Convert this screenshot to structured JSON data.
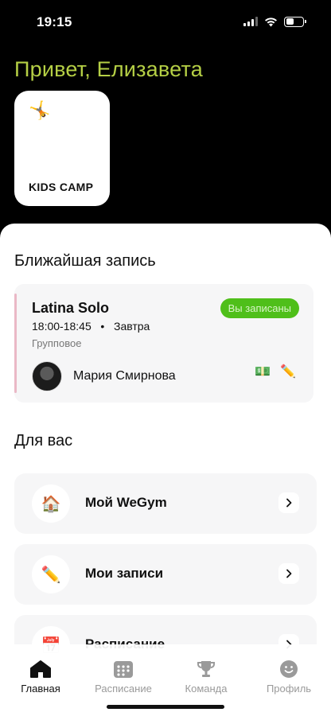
{
  "status_bar": {
    "time": "19:15"
  },
  "greeting": "Привет, Елизавета",
  "kids_card": {
    "title": "KIDS CAMP",
    "emoji": "🤸"
  },
  "nearest": {
    "section_title": "Ближайшая запись",
    "class_name": "Latina Solo",
    "time": "18:00-18:45",
    "day": "Завтра",
    "type": "Групповое",
    "badge": "Вы записаны",
    "trainer": "Мария Смирнова",
    "icons": [
      "money-icon",
      "pencil-icon"
    ],
    "accent_color": "#eab8c6",
    "badge_color": "#4fbf1a"
  },
  "for_you": {
    "section_title": "Для вас",
    "items": [
      {
        "label": "Мой WeGym",
        "emoji": "🏠",
        "icon": "house-icon"
      },
      {
        "label": "Мои записи",
        "emoji": "✏️",
        "icon": "pencil-icon"
      },
      {
        "label": "Расписание",
        "emoji": "📅",
        "icon": "calendar-icon"
      }
    ]
  },
  "tabs": [
    {
      "label": "Главная",
      "icon": "home-icon",
      "active": true
    },
    {
      "label": "Расписание",
      "icon": "calendar-icon",
      "active": false
    },
    {
      "label": "Команда",
      "icon": "trophy-icon",
      "active": false
    },
    {
      "label": "Профиль",
      "icon": "smile-icon",
      "active": false
    }
  ],
  "colors": {
    "greeting": "#b5cf45",
    "background": "#000000"
  }
}
